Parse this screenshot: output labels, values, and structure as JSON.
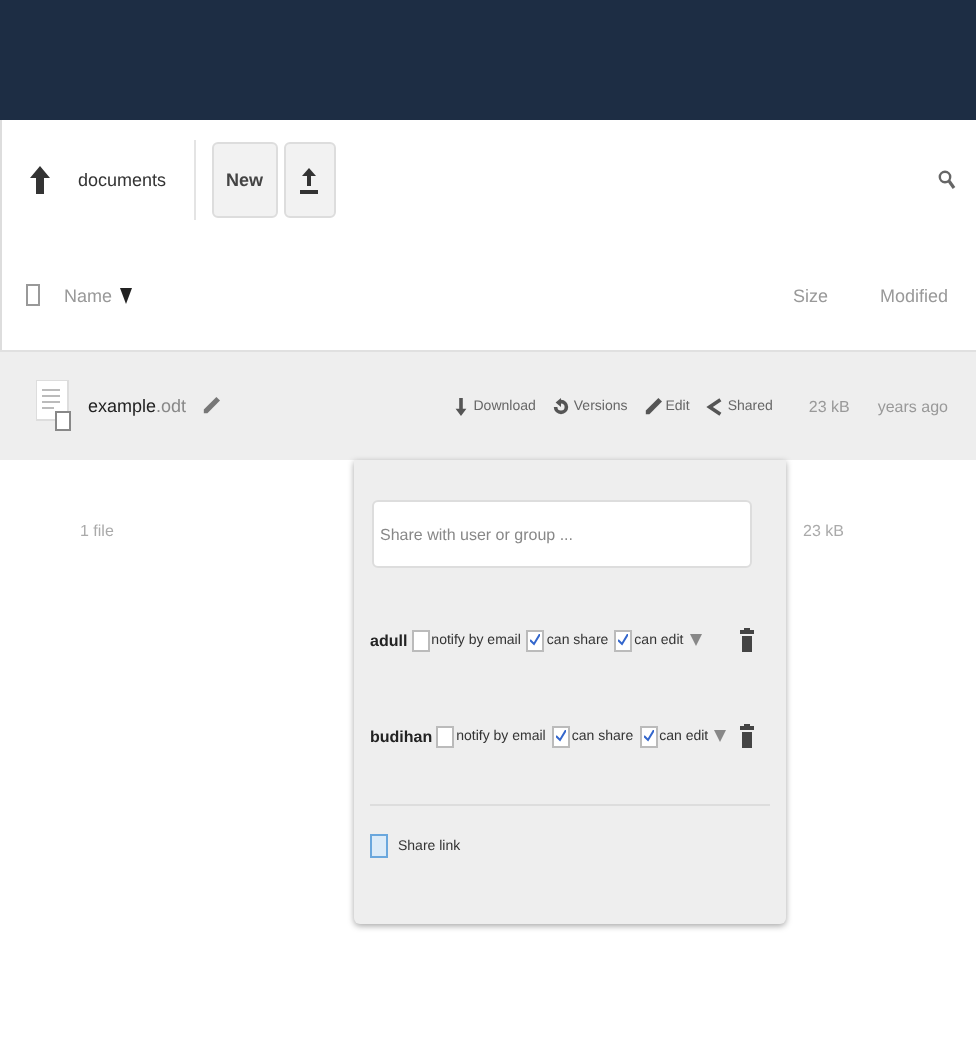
{
  "breadcrumb": [
    {
      "label": "documents"
    }
  ],
  "new_button": "New",
  "select_all": {
    "checked": false
  },
  "columns": {
    "name": "Name",
    "size": "Size",
    "modified": "Modified"
  },
  "files": [
    {
      "name": "example",
      "ext": ".odt",
      "highlighted": true,
      "size": "23 kB",
      "modified": "years ago",
      "actions": [
        {
          "kind": "download",
          "label": "Download"
        },
        {
          "kind": "versions",
          "label": "Versions"
        },
        {
          "kind": "edit",
          "label": "Edit"
        },
        {
          "kind": "share",
          "label": "Shared"
        }
      ]
    }
  ],
  "summary": {
    "count": "1 file",
    "size": "23 kB"
  },
  "share_popup": {
    "placeholder": "Share with user or group ...",
    "shares": [
      {
        "user": "adull",
        "options": [
          {
            "label": "notify by email",
            "checked": false
          },
          {
            "label": "can share",
            "checked": true
          },
          {
            "label": "can edit",
            "checked": true
          }
        ]
      },
      {
        "user": "budihan",
        "options": [
          {
            "label": "notify by email",
            "checked": false
          },
          {
            "label": "can share",
            "checked": true
          },
          {
            "label": "can edit",
            "checked": true
          }
        ]
      }
    ],
    "link": {
      "label": "Share link",
      "checked": false
    }
  }
}
